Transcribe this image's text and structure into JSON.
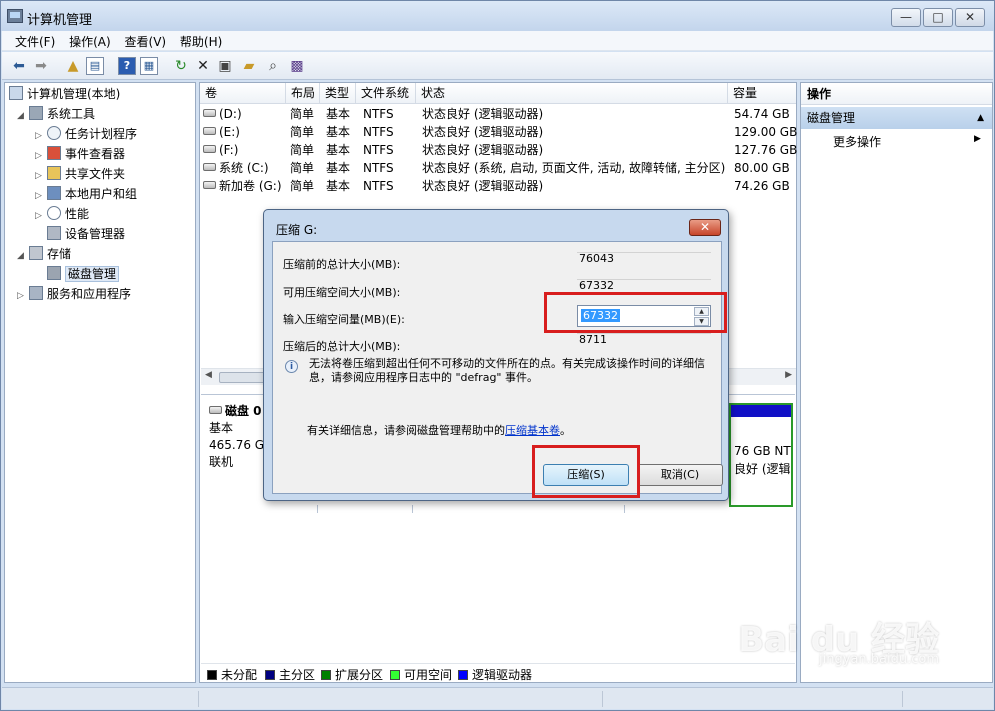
{
  "window": {
    "title": "计算机管理",
    "minimize_glyph": "—",
    "maximize_glyph": "□",
    "close_glyph": "✕"
  },
  "menu": [
    "文件(F)",
    "操作(A)",
    "查看(V)",
    "帮助(H)"
  ],
  "toolbar_icons": [
    "back-icon",
    "forward-icon",
    "up-folder-icon",
    "show-hide-tree-icon",
    "help-icon",
    "properties-view-icon",
    "refresh-icon",
    "delete-icon",
    "properties-icon",
    "open-icon",
    "search-icon",
    "disk-icon"
  ],
  "tree": {
    "root": "计算机管理(本地)",
    "system_tools": "系统工具",
    "task_scheduler": "任务计划程序",
    "event_viewer": "事件查看器",
    "shared_folders": "共享文件夹",
    "local_users": "本地用户和组",
    "performance": "性能",
    "device_manager": "设备管理器",
    "storage": "存储",
    "disk_management": "磁盘管理",
    "services_apps": "服务和应用程序"
  },
  "volumes": {
    "headers": [
      "卷",
      "布局",
      "类型",
      "文件系统",
      "状态",
      "容量"
    ],
    "rows": [
      {
        "name": "(D:)",
        "layout": "简单",
        "type": "基本",
        "fs": "NTFS",
        "status": "状态良好 (逻辑驱动器)",
        "capacity": "54.74 GB"
      },
      {
        "name": "(E:)",
        "layout": "简单",
        "type": "基本",
        "fs": "NTFS",
        "status": "状态良好 (逻辑驱动器)",
        "capacity": "129.00 GB"
      },
      {
        "name": "(F:)",
        "layout": "简单",
        "type": "基本",
        "fs": "NTFS",
        "status": "状态良好 (逻辑驱动器)",
        "capacity": "127.76 GB"
      },
      {
        "name": "系统 (C:)",
        "layout": "简单",
        "type": "基本",
        "fs": "NTFS",
        "status": "状态良好 (系统, 启动, 页面文件, 活动, 故障转储, 主分区)",
        "capacity": "80.00 GB"
      },
      {
        "name": "新加卷 (G:)",
        "layout": "简单",
        "type": "基本",
        "fs": "NTFS",
        "status": "状态良好 (逻辑驱动器)",
        "capacity": "74.26 GB"
      }
    ]
  },
  "graphical": {
    "disk_name": "磁盘 0",
    "disk_type": "基本",
    "disk_size": "465.76 GB",
    "disk_status": "联机",
    "seg_line1": "76 GB NT",
    "seg_line2": "良好 (逻辑"
  },
  "legend": [
    {
      "label": "未分配",
      "color": "#000000"
    },
    {
      "label": "主分区",
      "color": "#000080"
    },
    {
      "label": "扩展分区",
      "color": "#008000"
    },
    {
      "label": "可用空间",
      "color": "#33ff33"
    },
    {
      "label": "逻辑驱动器",
      "color": "#0000ff"
    }
  ],
  "actions": {
    "header": "操作",
    "section": "磁盘管理",
    "more": "更多操作"
  },
  "dialog": {
    "title": "压缩 G:",
    "close_glyph": "✕",
    "total_before_label": "压缩前的总计大小(MB):",
    "total_before_value": "76043",
    "available_label": "可用压缩空间大小(MB):",
    "available_value": "67332",
    "input_label": "输入压缩空间量(MB)(E):",
    "input_value": "67332",
    "total_after_label": "压缩后的总计大小(MB):",
    "total_after_value": "8711",
    "info_text": "无法将卷压缩到超出任何不可移动的文件所在的点。有关完成该操作时间的详细信息，请参阅应用程序日志中的 \"defrag\" 事件。",
    "help_prefix": "有关详细信息，请参阅磁盘管理帮助中的",
    "help_link": "压缩基本卷",
    "help_suffix": "。",
    "shrink_button": "压缩(S)",
    "cancel_button": "取消(C)"
  },
  "watermark": {
    "brand": "Bai du 经验",
    "url": "jingyan.baidu.com"
  },
  "colors": {
    "highlight": "#d81e1e",
    "selection": "#3399ff",
    "logical_drive": "#1010c6"
  }
}
